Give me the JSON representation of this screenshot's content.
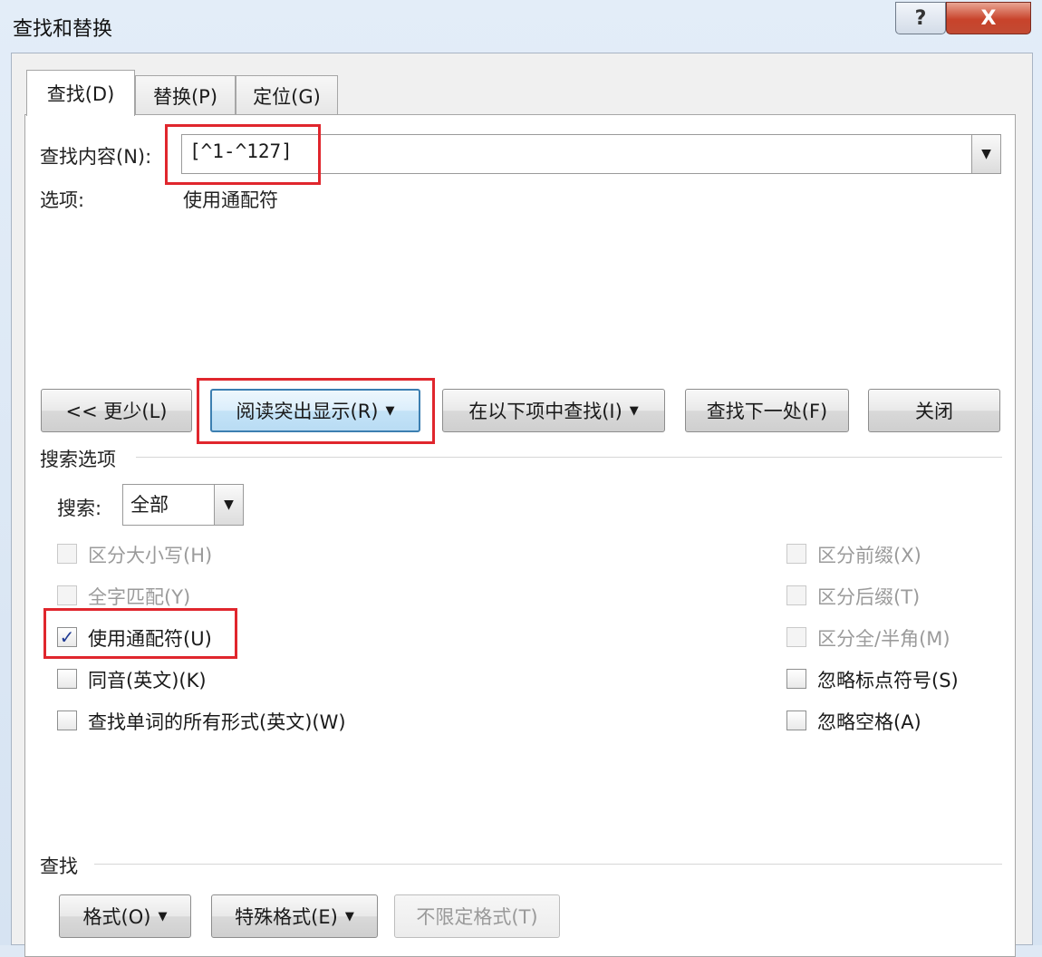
{
  "window": {
    "title": "查找和替换",
    "help_label": "?",
    "close_label": "X"
  },
  "tabs": [
    {
      "label": "查找(D)",
      "active": true
    },
    {
      "label": "替换(P)",
      "active": false
    },
    {
      "label": "定位(G)",
      "active": false
    }
  ],
  "find": {
    "label": "查找内容(N):",
    "value": "[^1-^127]",
    "options_label": "选项:",
    "options_value": "使用通配符"
  },
  "buttons": {
    "less": "<< 更少(L)",
    "reading_highlight": "阅读突出显示(R)",
    "find_in": "在以下项中查找(I)",
    "find_next": "查找下一处(F)",
    "close": "关闭"
  },
  "search_options": {
    "section_label": "搜索选项",
    "search_label": "搜索:",
    "search_value": "全部",
    "left_checks": [
      {
        "label": "区分大小写(H)",
        "checked": false,
        "enabled": false
      },
      {
        "label": "全字匹配(Y)",
        "checked": false,
        "enabled": false
      },
      {
        "label": "使用通配符(U)",
        "checked": true,
        "enabled": true
      },
      {
        "label": "同音(英文)(K)",
        "checked": false,
        "enabled": true
      },
      {
        "label": "查找单词的所有形式(英文)(W)",
        "checked": false,
        "enabled": true
      }
    ],
    "right_checks": [
      {
        "label": "区分前缀(X)",
        "checked": false,
        "enabled": false
      },
      {
        "label": "区分后缀(T)",
        "checked": false,
        "enabled": false
      },
      {
        "label": "区分全/半角(M)",
        "checked": false,
        "enabled": false
      },
      {
        "label": "忽略标点符号(S)",
        "checked": false,
        "enabled": true
      },
      {
        "label": "忽略空格(A)",
        "checked": false,
        "enabled": true
      }
    ]
  },
  "find_section": {
    "label": "查找",
    "format": "格式(O)",
    "special": "特殊格式(E)",
    "no_format": "不限定格式(T)"
  },
  "colors": {
    "highlight_box": "#e0262d",
    "checkmark": "#1f3a93"
  },
  "icons": {
    "dropdown": "▼",
    "check": "✓"
  }
}
